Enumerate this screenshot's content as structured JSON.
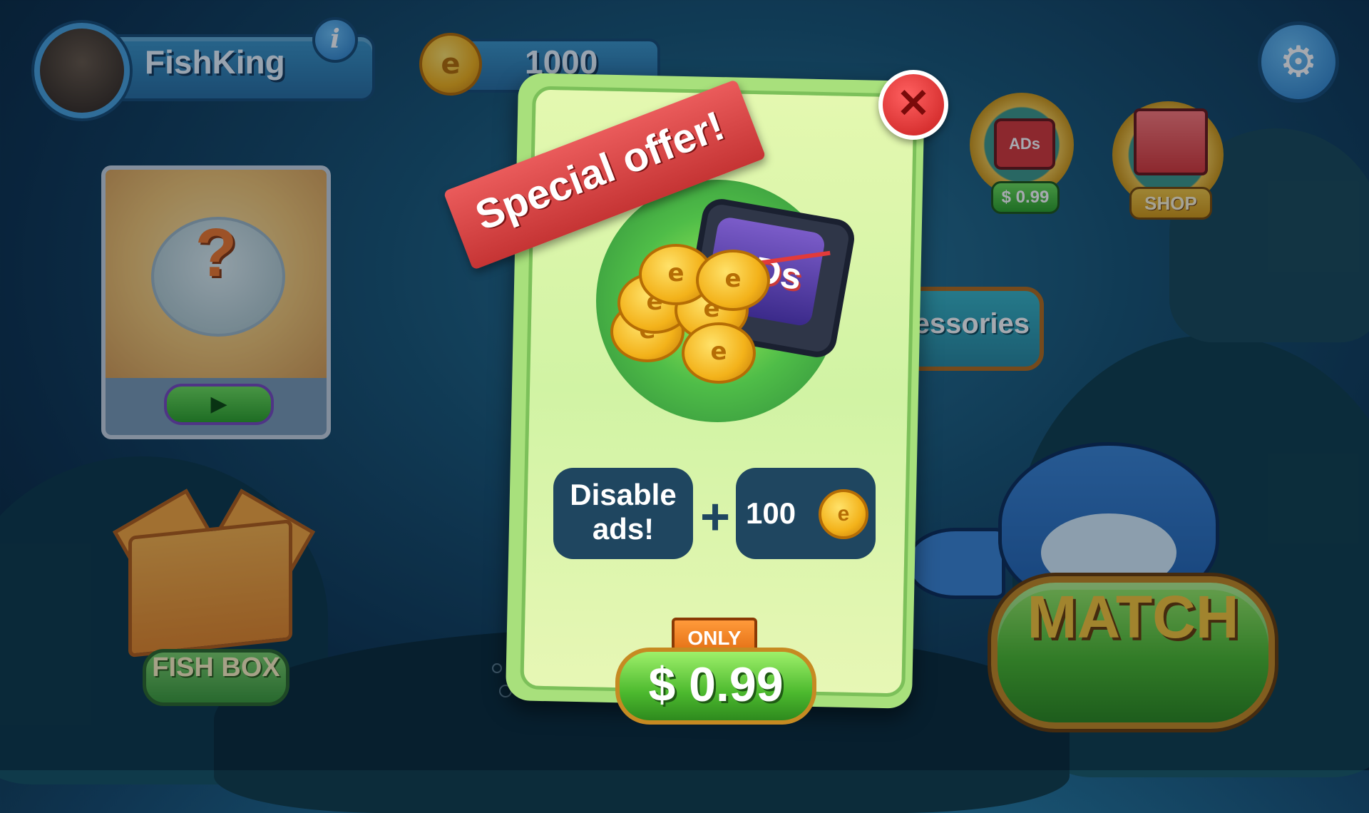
{
  "player": {
    "name": "FishKing",
    "info_icon": "i"
  },
  "currency": {
    "coins": "1000",
    "coin_symbol": "e"
  },
  "settings": {
    "icon": "gear-icon"
  },
  "mystery": {
    "question": "?",
    "play_icon": "▶"
  },
  "fish_box": {
    "label": "FISH BOX"
  },
  "ads_offer": {
    "tv_text": "ADs",
    "price": "$ 0.99"
  },
  "shop": {
    "label": "SHOP"
  },
  "accessories": {
    "label": "Accessories"
  },
  "match": {
    "label": "MATCH"
  },
  "popup": {
    "ribbon": "Special offer!",
    "close": "✕",
    "tv_text": "ADs",
    "disable_ads": "Disable ads!",
    "plus": "+",
    "coins_amount": "100",
    "only": "ONLY",
    "price": "$ 0.99"
  },
  "colors": {
    "popup_bg": "#d1f3a4",
    "ribbon": "#c53434",
    "match_button": "#4cb92e",
    "coin": "#f3b21a"
  }
}
